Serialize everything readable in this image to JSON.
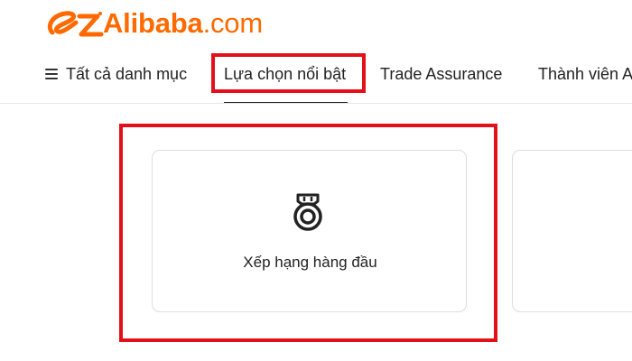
{
  "brand": {
    "name": "Alibaba",
    "suffix": ".com",
    "color": "#ff6a00"
  },
  "nav": {
    "items": [
      {
        "label": "Tất cả danh mục",
        "icon": "menu-icon"
      },
      {
        "label": "Lựa chọn nổi bật",
        "active": true
      },
      {
        "label": "Trade Assurance"
      },
      {
        "label": "Thành viên A"
      }
    ]
  },
  "cards": [
    {
      "label": "Xếp hạng hàng đầu",
      "icon": "ranking-medal-icon"
    }
  ],
  "colors": {
    "accent": "#ff6a00",
    "highlight": "#e3101c",
    "text": "#222222",
    "border": "#dddddd"
  }
}
